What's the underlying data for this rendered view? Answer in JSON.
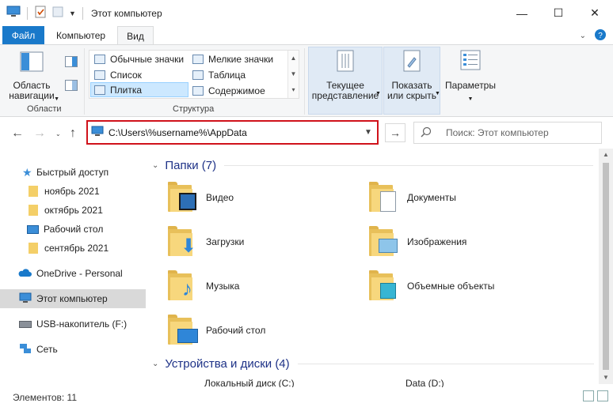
{
  "window": {
    "title": "Этот компьютер",
    "controls": {
      "minimize": "—",
      "maximize": "☐",
      "close": "✕"
    }
  },
  "ribbon_tabs": {
    "file": "Файл",
    "computer": "Компьютер",
    "view": "Вид"
  },
  "ribbon": {
    "panes_group": {
      "nav_pane_label_1": "Область",
      "nav_pane_label_2": "навигации",
      "group_label": "Области"
    },
    "layout_group": {
      "items": [
        "Обычные значки",
        "Мелкие значки",
        "Список",
        "Таблица",
        "Плитка",
        "Содержимое"
      ],
      "selected": "Плитка",
      "group_label": "Структура"
    },
    "current_view": {
      "line1": "Текущее",
      "line2": "представление"
    },
    "show_hide": {
      "line1": "Показать",
      "line2": "или скрыть"
    },
    "options": {
      "label": "Параметры"
    }
  },
  "address_bar": {
    "path": "C:\\Users\\%username%\\AppData"
  },
  "search": {
    "placeholder": "Поиск: Этот компьютер"
  },
  "sidebar": {
    "items": [
      {
        "label": "Быстрый доступ",
        "icon": "star-icon"
      },
      {
        "label": "ноябрь 2021",
        "icon": "folder-icon"
      },
      {
        "label": "октябрь 2021",
        "icon": "folder-icon"
      },
      {
        "label": "Рабочий стол",
        "icon": "desktop-icon"
      },
      {
        "label": "сентябрь 2021",
        "icon": "folder-icon"
      },
      {
        "label": "OneDrive - Personal",
        "icon": "cloud-icon"
      },
      {
        "label": "Этот компьютер",
        "icon": "computer-icon"
      },
      {
        "label": "USB-накопитель (F:)",
        "icon": "usb-drive-icon"
      },
      {
        "label": "Сеть",
        "icon": "network-icon"
      }
    ],
    "selected": "Этот компьютер"
  },
  "content": {
    "folders_header": "Папки (7)",
    "folders": [
      {
        "name": "Видео",
        "icon": "video-folder-icon"
      },
      {
        "name": "Документы",
        "icon": "documents-folder-icon"
      },
      {
        "name": "Загрузки",
        "icon": "downloads-folder-icon"
      },
      {
        "name": "Изображения",
        "icon": "pictures-folder-icon"
      },
      {
        "name": "Музыка",
        "icon": "music-folder-icon"
      },
      {
        "name": "Объемные объекты",
        "icon": "3d-objects-folder-icon"
      },
      {
        "name": "Рабочий стол",
        "icon": "desktop-folder-icon"
      }
    ],
    "drives_header": "Устройства и диски (4)",
    "drives": [
      {
        "name": "Локальный диск (C:)"
      },
      {
        "name": "Data (D:)"
      }
    ]
  },
  "status": {
    "items_count": "Элементов: 11"
  },
  "colors": {
    "file_tab": "#1979ca",
    "address_highlight": "#d0121b",
    "group_header": "#1e3287",
    "folder": "#f7d77d"
  }
}
